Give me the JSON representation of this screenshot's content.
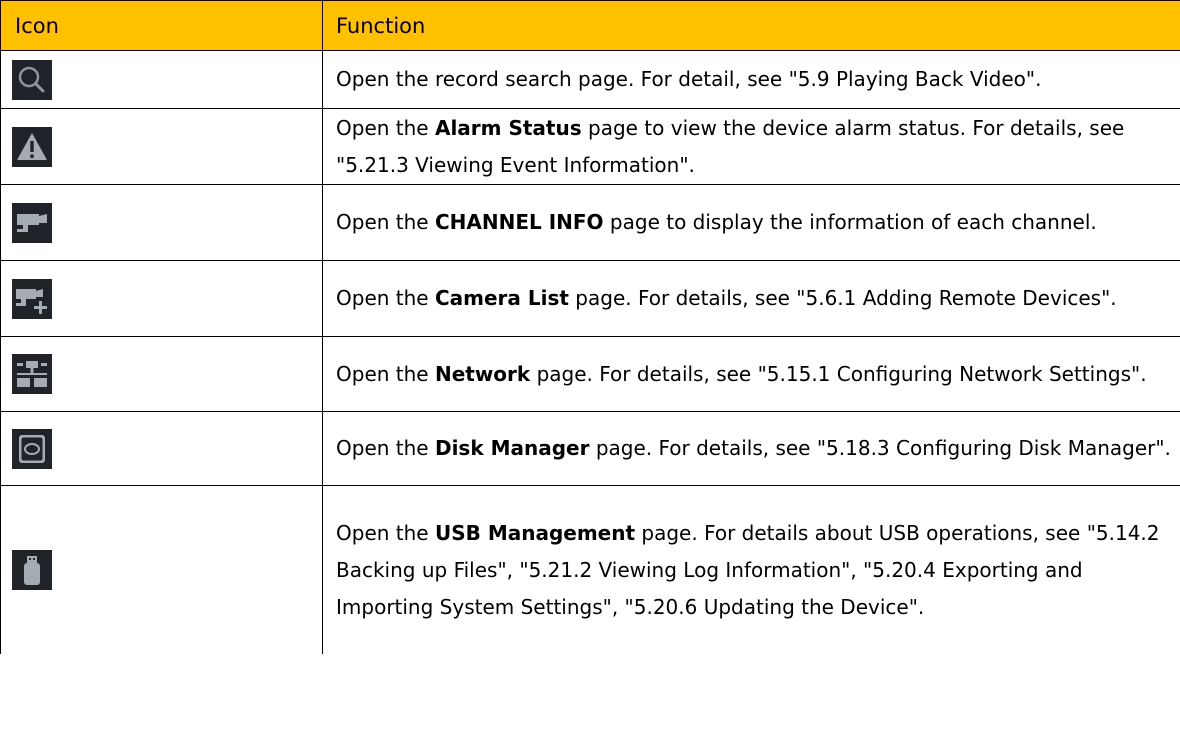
{
  "header": {
    "icon": "Icon",
    "function": "Function"
  },
  "rows": [
    {
      "icon": "search-icon",
      "pre": "Open the record search page. For detail, see \"5.9 Playing Back Video\".",
      "bold": "",
      "post": ""
    },
    {
      "icon": "alarm-warning-icon",
      "pre": "Open the ",
      "bold": "Alarm Status",
      "post": " page to view the device alarm status. For details, see \"5.21.3 Viewing Event Information\"."
    },
    {
      "icon": "camera-icon",
      "pre": "Open the ",
      "bold": "CHANNEL INFO",
      "post": " page to display the information of each channel."
    },
    {
      "icon": "camera-add-icon",
      "pre": "Open the ",
      "bold": "Camera List",
      "post": " page. For details, see \"5.6.1 Adding Remote Devices\"."
    },
    {
      "icon": "network-icon",
      "pre": "Open the ",
      "bold": "Network",
      "post": " page. For details, see \"5.15.1 Configuring Network Settings\"."
    },
    {
      "icon": "disk-icon",
      "pre": "Open the ",
      "bold": "Disk Manager",
      "post": " page. For details, see \"5.18.3 Configuring Disk Manager\"."
    },
    {
      "icon": "usb-icon",
      "pre": "Open the ",
      "bold": "USB Management",
      "post": " page. For details about USB operations, see \"5.14.2 Backing up Files\", \"5.21.2 Viewing Log Information\", \"5.20.4 Exporting and Importing System Settings\", \"5.20.6 Updating the Device\"."
    }
  ]
}
